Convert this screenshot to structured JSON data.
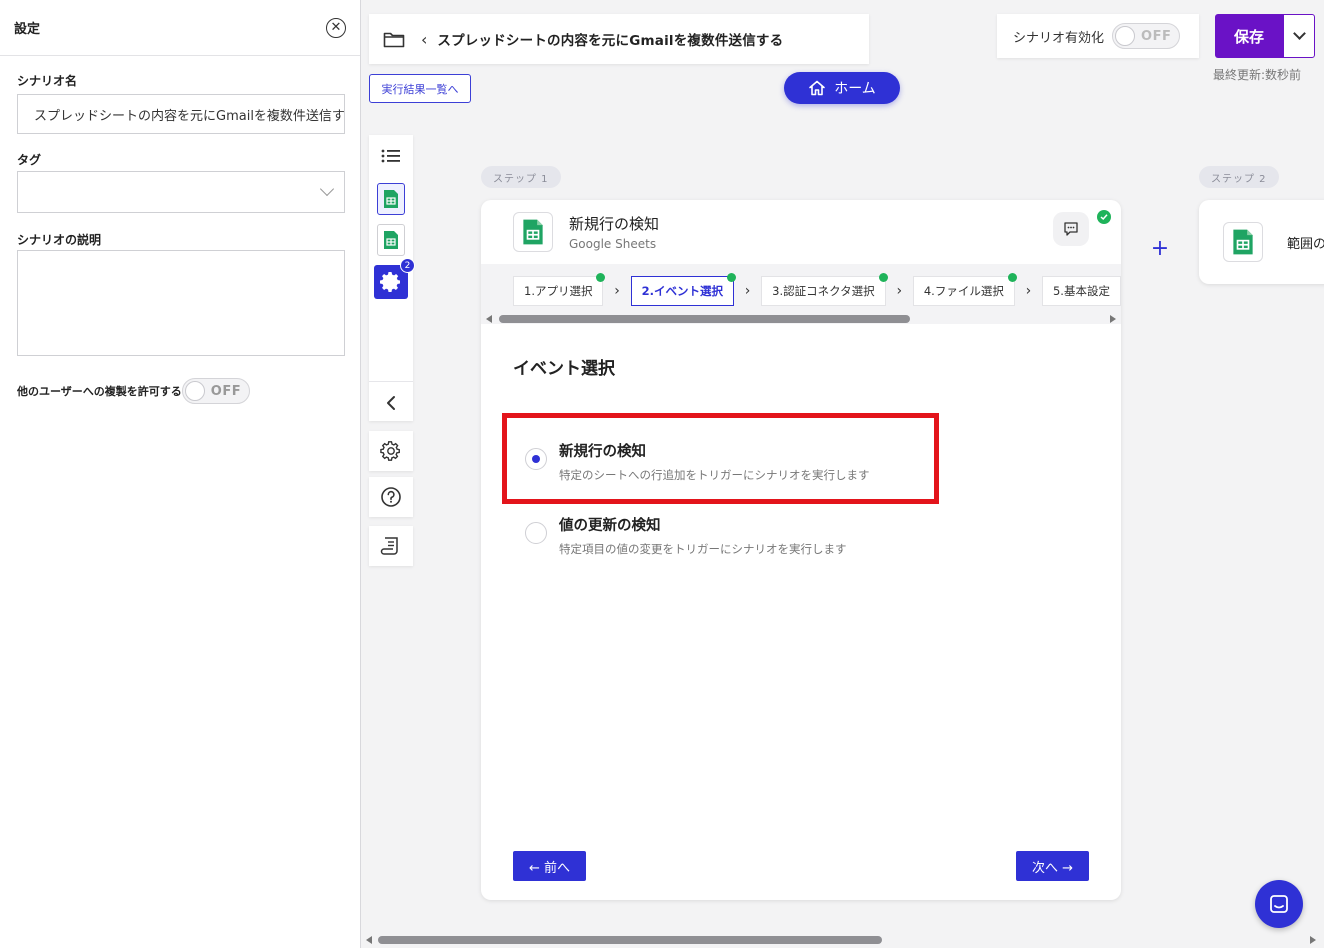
{
  "settings": {
    "title": "設定",
    "scenario_name_label": "シナリオ名",
    "scenario_name_value": "スプレッドシートの内容を元にGmailを複数件送信する",
    "tag_label": "タグ",
    "description_label": "シナリオの説明",
    "allow_copy_label": "他のユーザーへの複製を許可する",
    "allow_copy_toggle": "OFF"
  },
  "header": {
    "breadcrumb_title": "スプレッドシートの内容を元にGmailを複数件送信する",
    "results_button": "実行結果一覧へ",
    "home_button": "ホーム",
    "activate_label": "シナリオ有効化",
    "activate_toggle": "OFF",
    "save_button": "保存",
    "last_updated": "最終更新:数秒前"
  },
  "toolbar": {
    "badge_count": "2"
  },
  "steps": {
    "step1_label": "ステップ 1",
    "step2_label": "ステップ 2"
  },
  "card": {
    "title": "新規行の検知",
    "subtitle": "Google Sheets",
    "tabs": [
      {
        "label": "1.アプリ選択"
      },
      {
        "label": "2.イベント選択"
      },
      {
        "label": "3.認証コネクタ選択"
      },
      {
        "label": "4.ファイル選択"
      },
      {
        "label": "5.基本設定"
      }
    ],
    "section_title": "イベント選択",
    "options": [
      {
        "title": "新規行の検知",
        "desc": "特定のシートへの行追加をトリガーにシナリオを実行します"
      },
      {
        "title": "値の更新の検知",
        "desc": "特定項目の値の変更をトリガーにシナリオを実行します"
      }
    ],
    "prev_button": "← 前へ",
    "next_button": "次へ →"
  },
  "card2": {
    "title": "範囲のセ"
  },
  "colors": {
    "accent": "#2f31d5",
    "save": "#6a12c6",
    "highlight": "#e3141b",
    "sheets_green": "#1fa463",
    "check_green": "#1fb35a"
  }
}
